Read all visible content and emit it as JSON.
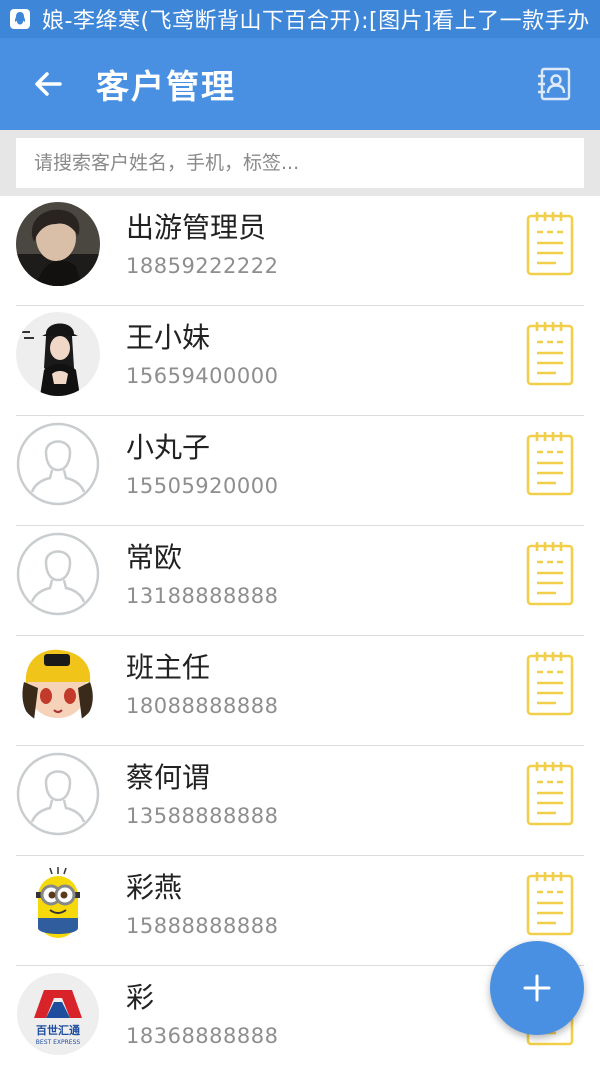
{
  "status_bar": {
    "ticker": "娘-李绛寒(飞鸢断背山下百合开):[图片]看上了一款手办"
  },
  "app_bar": {
    "title": "客户管理",
    "back_icon": "arrow-left-icon",
    "action_icon": "contact-card-icon"
  },
  "search": {
    "placeholder": "请搜索客户姓名，手机，标签...",
    "value": ""
  },
  "customers": [
    {
      "name": "出游管理员",
      "phone": "18859222222",
      "avatar": "photo-boy"
    },
    {
      "name": "王小妹",
      "phone": "15659400000",
      "avatar": "photo-girl"
    },
    {
      "name": "小丸子",
      "phone": "15505920000",
      "avatar": "default"
    },
    {
      "name": "常欧",
      "phone": "13188888888",
      "avatar": "default"
    },
    {
      "name": "班主任",
      "phone": "18088888888",
      "avatar": "cartoon-girl"
    },
    {
      "name": "蔡何谓",
      "phone": "13588888888",
      "avatar": "default"
    },
    {
      "name": "彩燕",
      "phone": "15888888888",
      "avatar": "minion"
    },
    {
      "name": "彩",
      "phone": "18368888888",
      "avatar": "logo-best-express"
    }
  ],
  "logo_text": {
    "cn": "百世汇通",
    "en": "BEST EXPRESS"
  },
  "fab": {
    "icon": "plus-icon",
    "label": "+"
  },
  "colors": {
    "status_bar": "#3d86d8",
    "app_bar": "#4a90e2",
    "note_icon": "#f2cf4a",
    "fab": "#4a90e2"
  }
}
